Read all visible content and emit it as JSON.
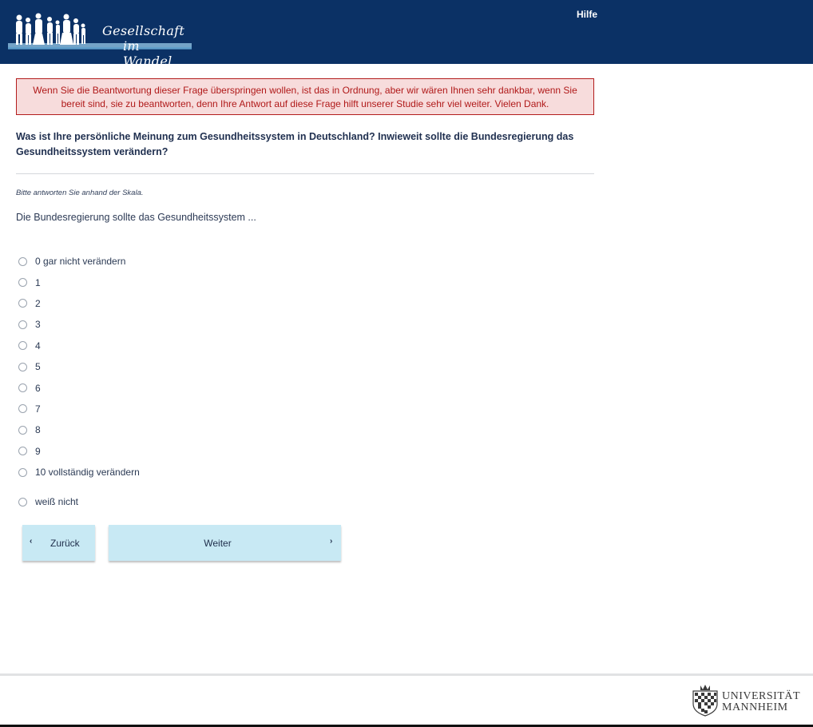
{
  "header": {
    "logo_line1": "Gesellschaft",
    "logo_line2": "im Wandel",
    "help_label": "Hilfe",
    "bg_color": "#0b3165"
  },
  "alert": {
    "text": "Wenn Sie die Beantwortung dieser Frage überspringen wollen, ist das in Ordnung, aber wir wären Ihnen sehr dankbar, wenn Sie bereit sind, sie zu beantworten, denn Ihre Antwort auf diese Frage hilft unserer Studie sehr viel weiter. Vielen Dank."
  },
  "question": {
    "text": "Was ist Ihre persönliche Meinung zum Gesundheitssystem in Deutschland? Inwieweit sollte die Bundesregierung das Gesundheitssystem verändern?",
    "instruction": "Bitte antworten Sie anhand der Skala.",
    "stem": "Die Bundesregierung sollte das Gesundheitssystem ..."
  },
  "options": [
    "0 gar nicht verändern",
    "1",
    "2",
    "3",
    "4",
    "5",
    "6",
    "7",
    "8",
    "9",
    "10 vollständig verändern"
  ],
  "dont_know": "weiß nicht",
  "nav": {
    "back_label": "Zurück",
    "next_label": "Weiter",
    "button_color": "#c8e9f4"
  },
  "footer": {
    "uni_line1": "UNIVERSITÄT",
    "uni_line2": "MANNHEIM"
  }
}
